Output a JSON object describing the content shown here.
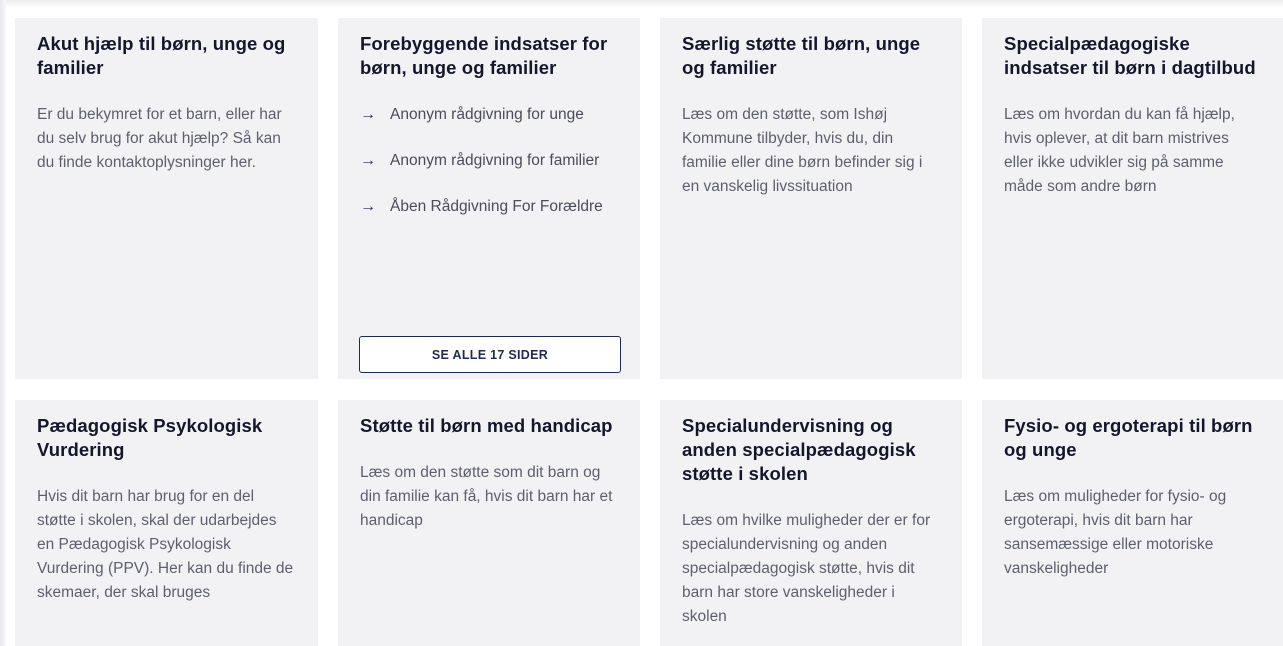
{
  "cards": [
    {
      "title": "Akut hjælp til børn, unge og familier",
      "description": "Er du bekymret for et barn, eller har du selv brug for akut hjælp? Så kan du finde kontaktoplysninger her."
    },
    {
      "title": "Forebyggende indsatser for børn, unge og familier",
      "links": [
        "Anonym rådgivning for unge",
        "Anonym rådgivning for familier",
        "Åben Rådgivning For Forældre"
      ],
      "link_arrow": "→",
      "button_label": "SE ALLE 17 SIDER"
    },
    {
      "title": "Særlig støtte til børn, unge og familier",
      "description": "Læs om den støtte, som Ishøj Kommune tilbyder, hvis du, din familie eller dine børn befinder sig i en vanskelig livssituation"
    },
    {
      "title": "Specialpædagogiske indsatser til børn i dagtilbud",
      "description": "Læs om hvordan du kan få hjælp, hvis oplever, at dit barn mistrives eller ikke udvikler sig på samme måde som andre børn"
    },
    {
      "title": "Pædagogisk Psykologisk Vurdering",
      "description": "Hvis dit barn har brug for en del støtte i skolen, skal der udarbejdes en Pædagogisk Psykologisk Vurdering (PPV). Her kan du finde de skemaer, der skal bruges"
    },
    {
      "title": "Støtte til børn med handicap",
      "description": "Læs om den støtte som dit barn og din familie kan få, hvis dit barn har et handicap"
    },
    {
      "title": "Specialundervisning og anden specialpædagogisk støtte i skolen",
      "description": "Læs om hvilke muligheder der er for specialundervisning og anden specialpædagogisk støtte, hvis dit barn har store vanskeligheder i skolen"
    },
    {
      "title": "Fysio- og ergoterapi til børn og unge",
      "description": "Læs om muligheder for fysio- og ergoterapi, hvis dit barn har sansemæssige eller motoriske vanskeligheder"
    }
  ],
  "colors": {
    "card_background": "#f2f2f5",
    "title_text": "#14162c",
    "body_text": "#5d5f6c",
    "accent_navy": "#1f2a52"
  }
}
